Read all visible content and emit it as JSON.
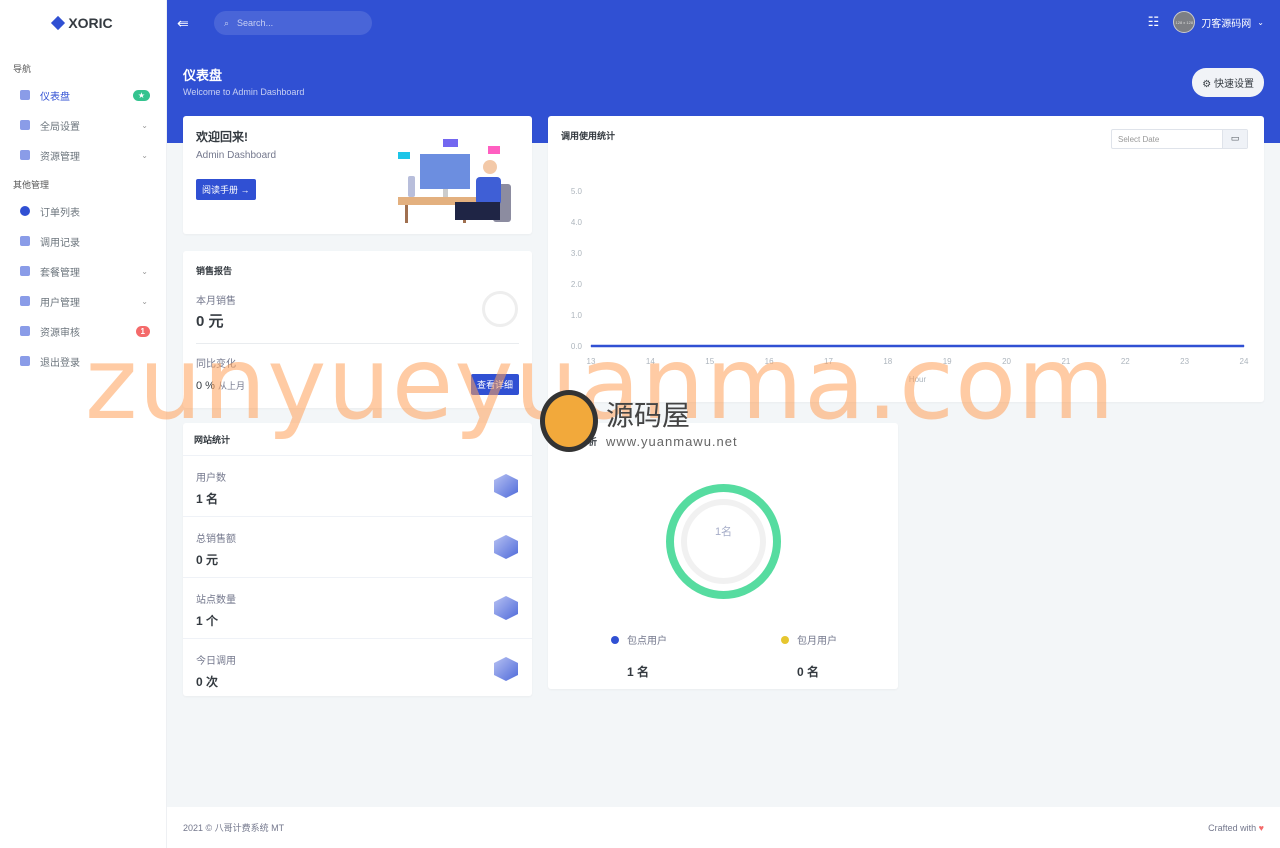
{
  "app": {
    "logo": "XORIC"
  },
  "sidebar": {
    "section1": "导航",
    "section2": "其他管理",
    "items": [
      {
        "label": "仪表盘",
        "badge": "★",
        "badge_color": "#34c38f",
        "active": true
      },
      {
        "label": "全局设置",
        "chevron": true
      },
      {
        "label": "资源管理",
        "chevron": true
      },
      {
        "label": "订单列表"
      },
      {
        "label": "调用记录"
      },
      {
        "label": "套餐管理",
        "chevron": true
      },
      {
        "label": "用户管理",
        "chevron": true
      },
      {
        "label": "资源审核",
        "badge": "1",
        "badge_color": "#f46a6a"
      },
      {
        "label": "退出登录"
      }
    ]
  },
  "topbar": {
    "search_placeholder": "Search...",
    "user": "刀客源码网",
    "avatar_text": "128 x 128"
  },
  "page": {
    "title": "仪表盘",
    "subtitle": "Welcome to Admin Dashboard",
    "quick_settings": "快速设置"
  },
  "welcome": {
    "title": "欢迎回来!",
    "subtitle": "Admin Dashboard",
    "button": "阅读手册 →"
  },
  "sales": {
    "title": "销售报告",
    "month_label": "本月销售",
    "month_value": "0 元",
    "change_label": "同比变化",
    "change_value": "0 %",
    "change_suffix": "从上月",
    "button": "查看详细"
  },
  "site_stats": {
    "title": "网站统计",
    "rows": [
      {
        "label": "用户数",
        "value": "1 名",
        "icon": "layers-icon"
      },
      {
        "label": "总销售额",
        "value": "0 元",
        "icon": "bar-chart-icon"
      },
      {
        "label": "站点数量",
        "value": "1 个",
        "icon": "ruler-icon"
      },
      {
        "label": "今日调用",
        "value": "0 次",
        "icon": "cube-icon"
      }
    ]
  },
  "user_analysis": {
    "title": "用户分析",
    "center": "1名",
    "legend": [
      {
        "label": "包点用户",
        "value": "1 名",
        "color": "#3050d3"
      },
      {
        "label": "包月用户",
        "value": "0 名",
        "color": "#e6c62f"
      }
    ],
    "ring_color": "#56dca0"
  },
  "usage": {
    "title": "调用使用统计",
    "date_placeholder": "Select Date"
  },
  "chart_data": {
    "type": "line",
    "xlabel": "Hour",
    "ylabel": "",
    "x": [
      13,
      14,
      15,
      16,
      17,
      18,
      19,
      20,
      21,
      22,
      23,
      24
    ],
    "series": [
      {
        "values": [
          0,
          0,
          0,
          0,
          0,
          0,
          0,
          0,
          0,
          0,
          0,
          0
        ],
        "color": "#3050d3"
      }
    ],
    "ylim": [
      0,
      5
    ],
    "yticks": [
      "0.0",
      "1.0",
      "2.0",
      "3.0",
      "4.0",
      "5.0"
    ],
    "grid": false
  },
  "footer": {
    "left": "2021 © 八哥计费系统 MT",
    "right": "Crafted with"
  },
  "watermark": {
    "text": "zunyueyuanma.com",
    "brand": "源码屋",
    "url": "www.yuanmawu.net"
  }
}
